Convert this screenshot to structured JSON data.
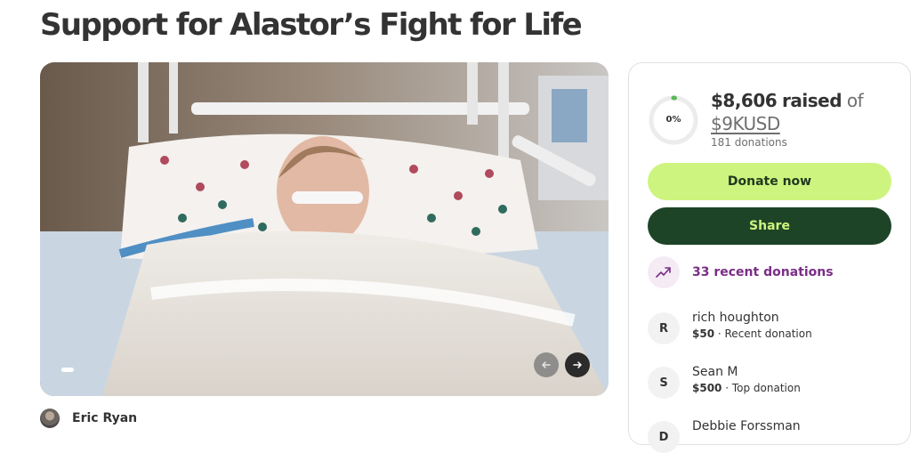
{
  "page": {
    "title": "Support for Alastor’s Fight for Life"
  },
  "hero": {
    "prev_icon": "arrow-left-icon",
    "next_icon": "arrow-right-icon"
  },
  "organizer": {
    "name": "Eric Ryan"
  },
  "fundraiser": {
    "progress_percent_label": "0%",
    "progress_fraction": 0.0,
    "raised_amount": "$8,606",
    "raised_word": "raised",
    "of_word": "of",
    "goal": "$9KUSD",
    "donation_count": "181 donations"
  },
  "actions": {
    "donate_label": "Donate now",
    "share_label": "Share"
  },
  "recent": {
    "icon": "trending-up-icon",
    "label": "33 recent donations"
  },
  "donors": [
    {
      "initial": "R",
      "name": "rich houghton",
      "amount": "$50",
      "note": " · Recent donation"
    },
    {
      "initial": "S",
      "name": "Sean M",
      "amount": "$500",
      "note": " · Top donation"
    },
    {
      "initial": "D",
      "name": "Debbie Forssman",
      "amount": "",
      "note": ""
    }
  ],
  "colors": {
    "donate_button": "#cdf47e",
    "share_button": "#1e4427",
    "recent_accent": "#7a2e86",
    "progress": "#5cb85c"
  }
}
